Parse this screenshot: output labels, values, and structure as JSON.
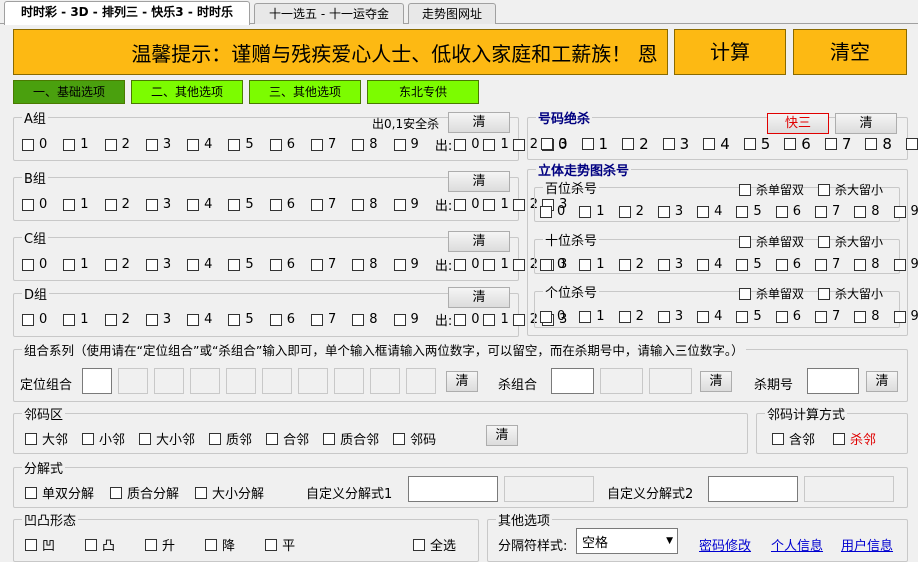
{
  "tabs": [
    "时时彩 - 3D - 排列三 - 快乐3 - 时时乐",
    "十一选五 - 十一运夺金",
    "走势图网址"
  ],
  "banner": "温馨提示：谨赠与残疾爱心人士、低收入家庭和工薪族！ 恩",
  "calc_label": "计算",
  "clear_label": "清空",
  "option_tabs": [
    "一、基础选项",
    "二、其他选项",
    "三、其他选项",
    "东北专供"
  ],
  "digits": [
    "0",
    "1",
    "2",
    "3",
    "4",
    "5",
    "6",
    "7",
    "8",
    "9"
  ],
  "out_prefix": "出:",
  "out_digits": [
    "0",
    "1",
    "2",
    "3"
  ],
  "clear": "清",
  "groups": [
    {
      "title": "A组",
      "note": "出0,1安全杀"
    },
    {
      "title": "B组"
    },
    {
      "title": "C组"
    },
    {
      "title": "D组"
    }
  ],
  "haoma": {
    "title": "号码绝杀",
    "kuai3": "快三"
  },
  "liti": {
    "title": "立体走势图杀号",
    "sections": [
      "百位杀号",
      "十位杀号",
      "个位杀号"
    ],
    "keep_double": "杀单留双",
    "keep_big": "杀大留小"
  },
  "combo": {
    "title": "组合系列（使用请在“定位组合”或“杀组合”输入即可，单个输入框请输入两位数字，可以留空，而在杀期号中，请输入三位数字。）",
    "dingwei": "定位组合",
    "sha": "杀组合",
    "qihao": "杀期号"
  },
  "neighbor": {
    "title": "邻码区",
    "items": [
      "大邻",
      "小邻",
      "大小邻",
      "质邻",
      "合邻",
      "质合邻",
      "邻码"
    ]
  },
  "neighbor_calc": {
    "title": "邻码计算方式",
    "he": "含邻",
    "sha": "杀邻"
  },
  "decomp": {
    "title": "分解式",
    "items": [
      "单双分解",
      "质合分解",
      "大小分解"
    ],
    "custom1": "自定义分解式1",
    "custom2": "自定义分解式2"
  },
  "aotu": {
    "title": "凹凸形态",
    "items": [
      "凹",
      "凸",
      "升",
      "降",
      "平"
    ],
    "all": "全选"
  },
  "other": {
    "title": "其他选项",
    "sep_label": "分隔符样式:",
    "sep_value": "空格",
    "links": [
      "密码修改",
      "个人信息",
      "用户信息"
    ]
  }
}
